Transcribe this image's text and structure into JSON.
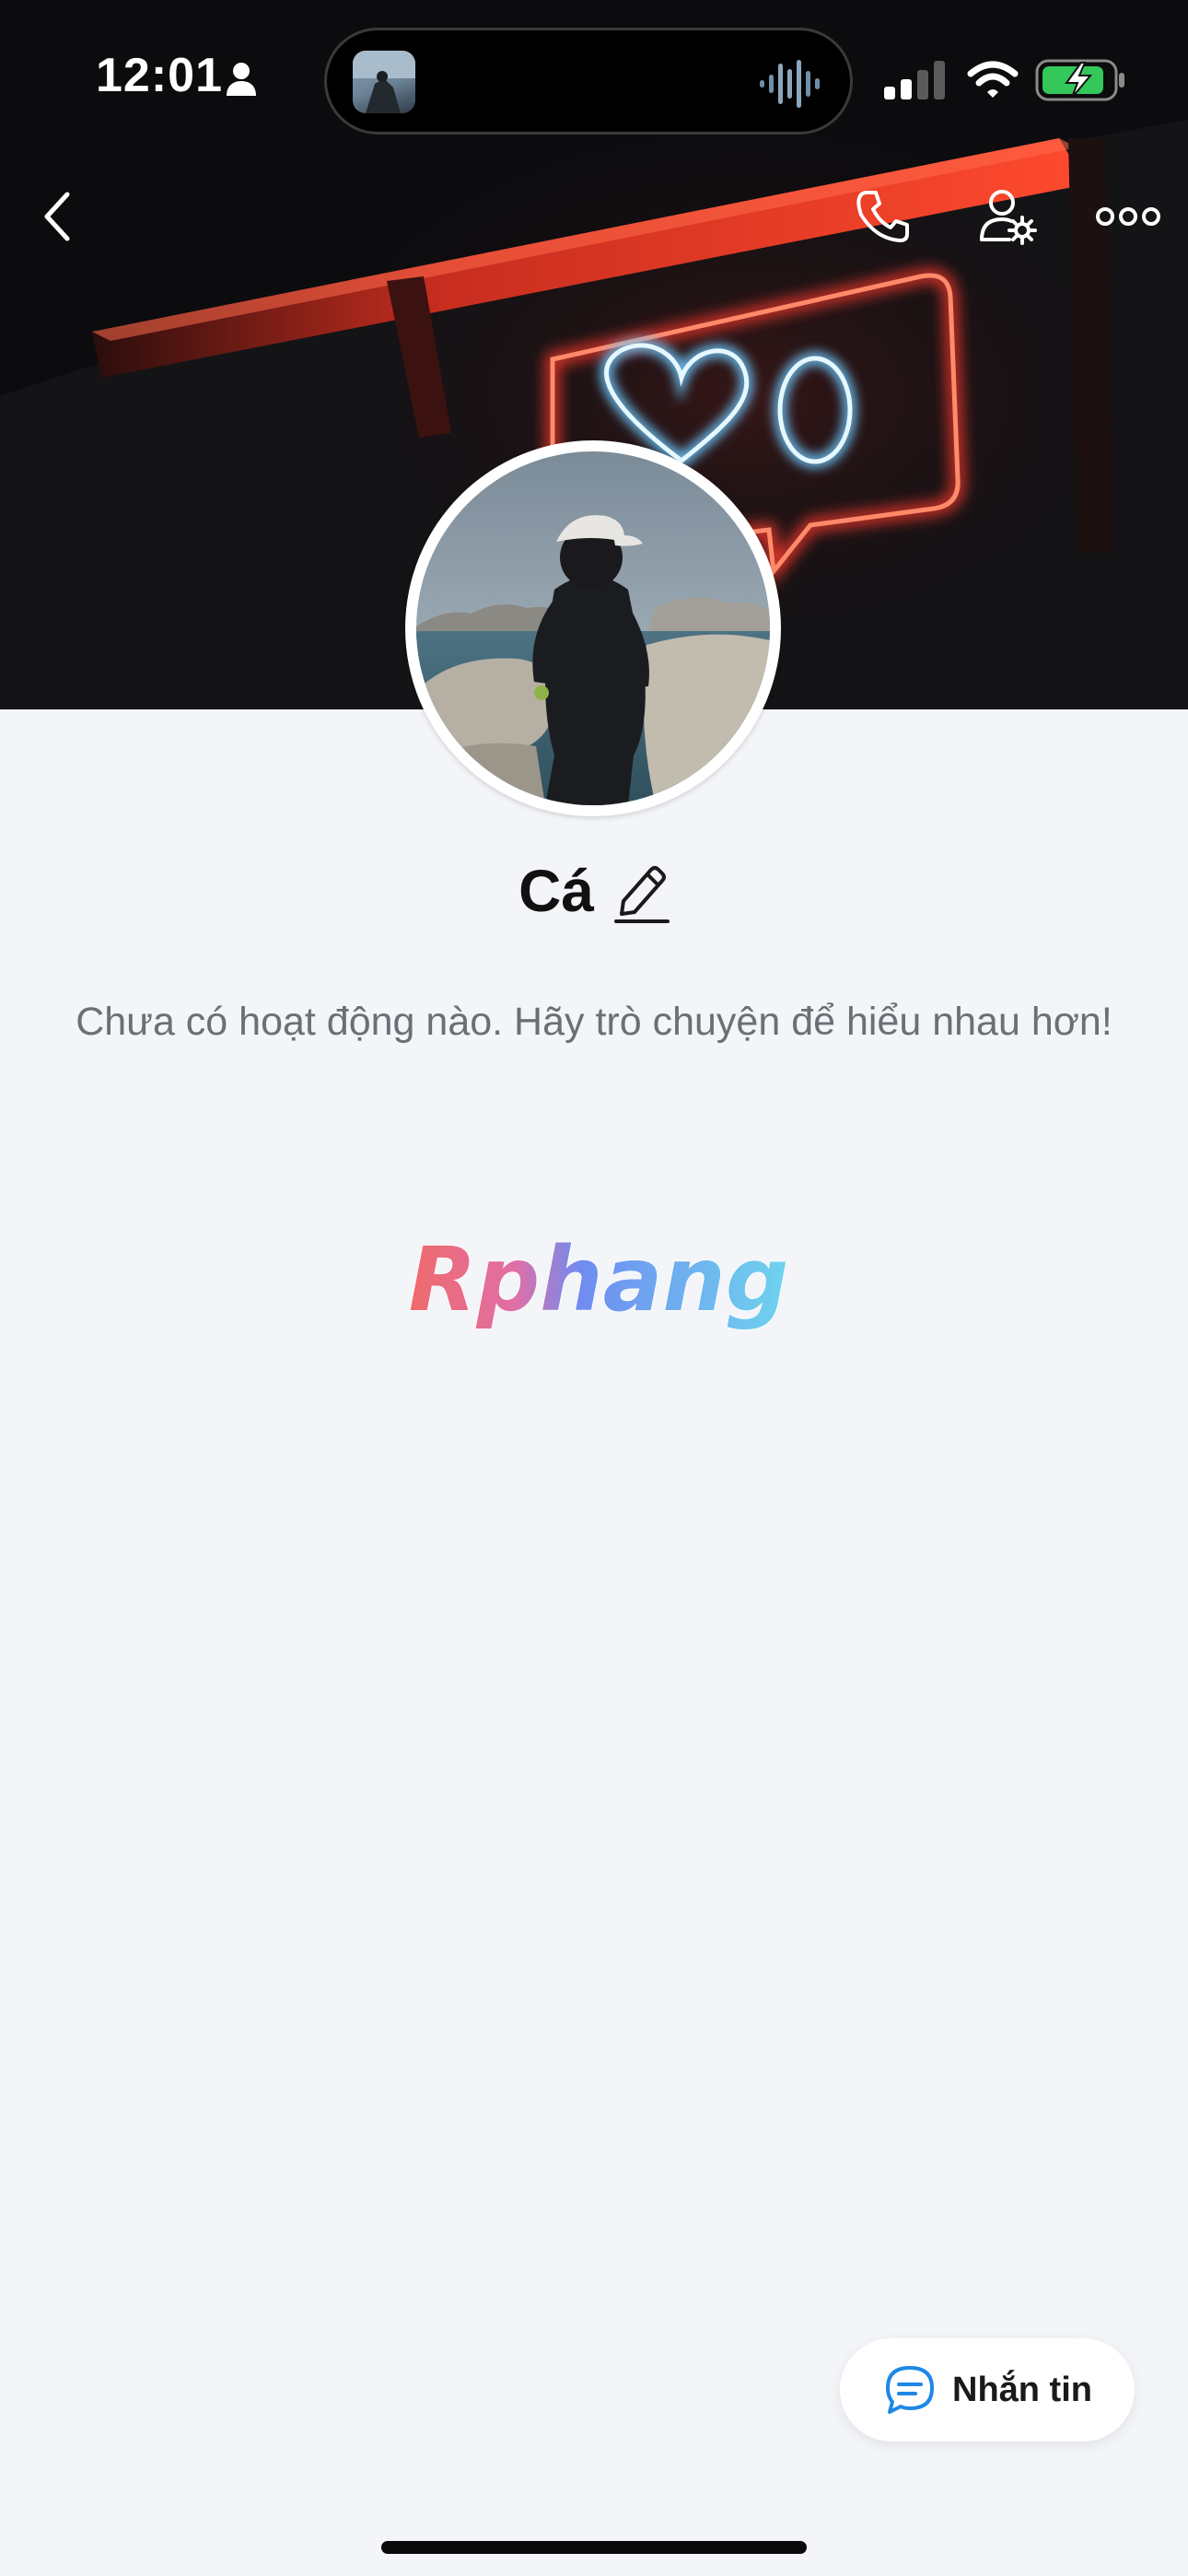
{
  "status_bar": {
    "time": "12:01"
  },
  "nav": {
    "back_icon": "chevron-left-icon",
    "call_icon": "phone-icon",
    "user_settings_icon": "user-gear-icon",
    "more_icon": "ellipsis-icon"
  },
  "profile": {
    "name": "Cá",
    "activity_text": "Chưa có hoạt động nào. Hãy trò chuyện để hiểu nhau hơn!"
  },
  "watermark": {
    "text": "Rphang"
  },
  "actions": {
    "message_label": "Nhắn tin"
  },
  "colors": {
    "background": "#f3f5f8",
    "neon_red": "#ff3b2f",
    "neon_blue": "#9fe3ff",
    "message_icon": "#1e88e5"
  }
}
